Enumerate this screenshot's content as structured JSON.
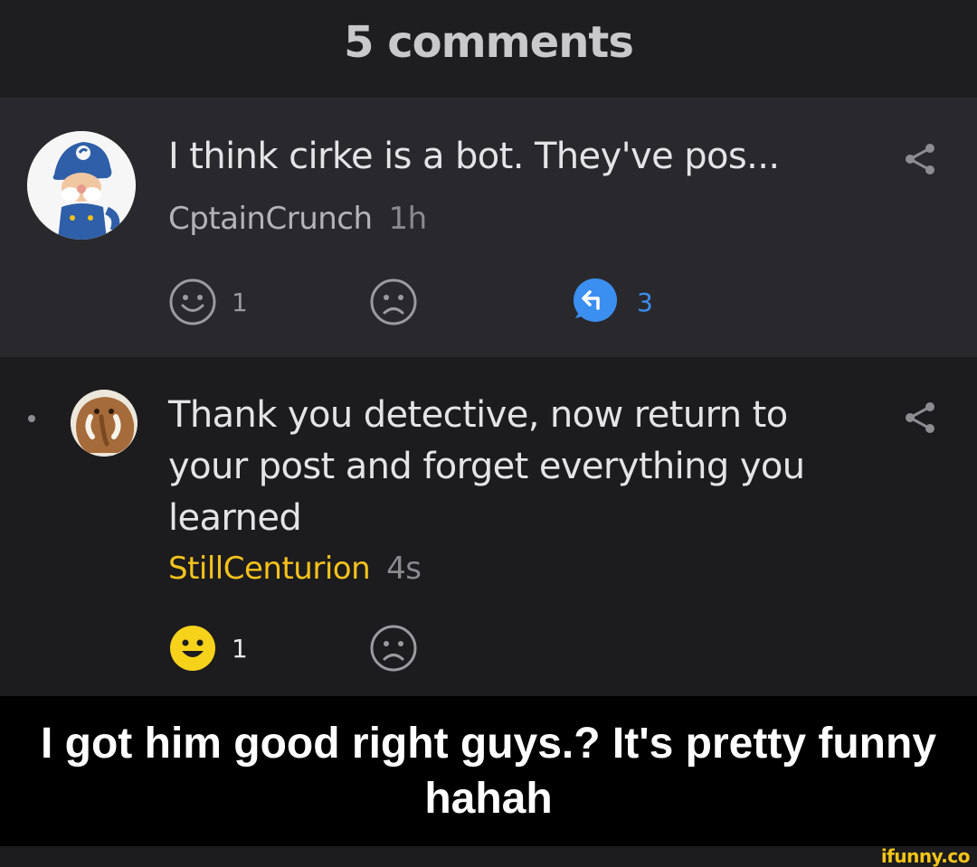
{
  "header": {
    "title": "5 comments"
  },
  "comments": [
    {
      "text": "I think cirke is a bot. They've pos...",
      "author": "CptainCrunch",
      "time": "1h",
      "smile_count": "1",
      "replies_count": "3",
      "avatar_icon": "captain-avatar-icon"
    },
    {
      "text": "Thank you detective, now return to your post and forget everything you learned",
      "author": "StillCenturion",
      "time": "4s",
      "smile_count": "1",
      "avatar_icon": "mammoth-avatar-icon"
    }
  ],
  "caption": {
    "text": "I got him good right guys.? It's pretty funny hahah"
  },
  "watermark": "ifunny.co",
  "colors": {
    "highlight_author": "#f4c21c",
    "reply_blue": "#3b8ff0",
    "active_smile": "#f7d21b"
  }
}
